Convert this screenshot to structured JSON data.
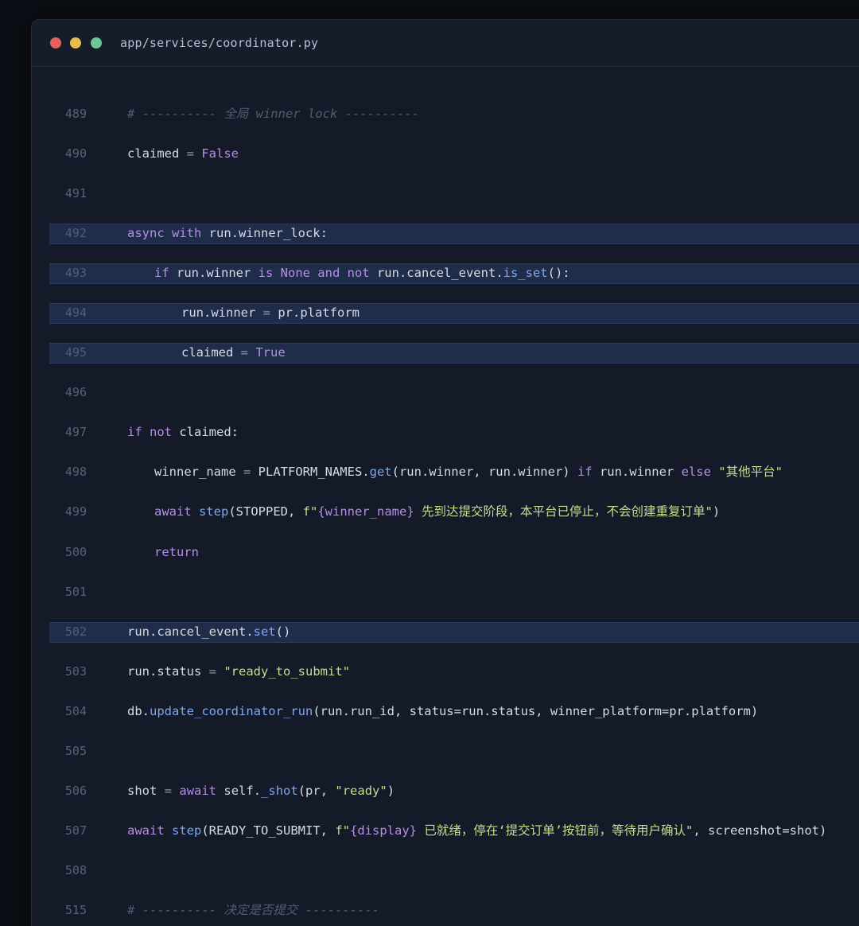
{
  "editor": {
    "filename": "app/services/coordinator.py"
  },
  "theme": {
    "keyword": "#b58ee8",
    "function": "#7fa7ee",
    "string": "#c6dc8e",
    "comment": "#525d70",
    "plain": "#d6dbe4",
    "highlight": "#1f2c4a"
  },
  "lines": [
    {
      "num": "489",
      "indent": 0,
      "highlighted": false,
      "tokens": [
        {
          "t": "cm",
          "v": "# ---------- 全局 winner lock ----------"
        }
      ]
    },
    {
      "num": "490",
      "indent": 0,
      "highlighted": false,
      "tokens": [
        {
          "t": "pl",
          "v": "claimed "
        },
        {
          "t": "op",
          "v": "="
        },
        {
          "t": "pl",
          "v": " "
        },
        {
          "t": "kw",
          "v": "False"
        }
      ]
    },
    {
      "num": "491",
      "indent": 0,
      "highlighted": false,
      "tokens": []
    },
    {
      "num": "492",
      "indent": 0,
      "highlighted": true,
      "tokens": [
        {
          "t": "kw",
          "v": "async with"
        },
        {
          "t": "pl",
          "v": " run.winner_lock:"
        }
      ]
    },
    {
      "num": "493",
      "indent": 1,
      "highlighted": true,
      "tokens": [
        {
          "t": "kw",
          "v": "if"
        },
        {
          "t": "pl",
          "v": " run.winner "
        },
        {
          "t": "kw",
          "v": "is None and not"
        },
        {
          "t": "pl",
          "v": " run.cancel_event."
        },
        {
          "t": "fn",
          "v": "is_set"
        },
        {
          "t": "pl",
          "v": "():"
        }
      ]
    },
    {
      "num": "494",
      "indent": 2,
      "highlighted": true,
      "tokens": [
        {
          "t": "pl",
          "v": "run.winner "
        },
        {
          "t": "op",
          "v": "="
        },
        {
          "t": "pl",
          "v": " pr.platform"
        }
      ]
    },
    {
      "num": "495",
      "indent": 2,
      "highlighted": true,
      "tokens": [
        {
          "t": "pl",
          "v": "claimed "
        },
        {
          "t": "op",
          "v": "="
        },
        {
          "t": "pl",
          "v": " "
        },
        {
          "t": "kw",
          "v": "True"
        }
      ]
    },
    {
      "num": "496",
      "indent": 0,
      "highlighted": false,
      "tokens": []
    },
    {
      "num": "497",
      "indent": 0,
      "highlighted": false,
      "tokens": [
        {
          "t": "kw",
          "v": "if not"
        },
        {
          "t": "pl",
          "v": " claimed:"
        }
      ]
    },
    {
      "num": "498",
      "indent": 1,
      "highlighted": false,
      "tokens": [
        {
          "t": "pl",
          "v": "winner_name "
        },
        {
          "t": "op",
          "v": "="
        },
        {
          "t": "pl",
          "v": " PLATFORM_NAMES."
        },
        {
          "t": "fn",
          "v": "get"
        },
        {
          "t": "pl",
          "v": "(run.winner, run.winner) "
        },
        {
          "t": "kw",
          "v": "if"
        },
        {
          "t": "pl",
          "v": " run.winner "
        },
        {
          "t": "kw",
          "v": "else"
        },
        {
          "t": "pl",
          "v": " "
        },
        {
          "t": "str",
          "v": "\"其他平台\""
        }
      ]
    },
    {
      "num": "499",
      "indent": 1,
      "highlighted": false,
      "tokens": [
        {
          "t": "kw",
          "v": "await"
        },
        {
          "t": "pl",
          "v": " "
        },
        {
          "t": "fn",
          "v": "step"
        },
        {
          "t": "pl",
          "v": "(STOPPED, "
        },
        {
          "t": "str",
          "v": "f\""
        },
        {
          "t": "kw",
          "v": "{winner_name}"
        },
        {
          "t": "str",
          "v": " 先到达提交阶段，本平台已停止，不会创建重复订单\""
        },
        {
          "t": "pl",
          "v": ")"
        }
      ]
    },
    {
      "num": "500",
      "indent": 1,
      "highlighted": false,
      "tokens": [
        {
          "t": "kw",
          "v": "return"
        }
      ]
    },
    {
      "num": "501",
      "indent": 0,
      "highlighted": false,
      "tokens": []
    },
    {
      "num": "502",
      "indent": 0,
      "highlighted": true,
      "tokens": [
        {
          "t": "pl",
          "v": "run.cancel_event."
        },
        {
          "t": "fn",
          "v": "set"
        },
        {
          "t": "pl",
          "v": "()"
        }
      ]
    },
    {
      "num": "503",
      "indent": 0,
      "highlighted": false,
      "tokens": [
        {
          "t": "pl",
          "v": "run.status "
        },
        {
          "t": "op",
          "v": "="
        },
        {
          "t": "pl",
          "v": " "
        },
        {
          "t": "str",
          "v": "\"ready_to_submit\""
        }
      ]
    },
    {
      "num": "504",
      "indent": 0,
      "highlighted": false,
      "tokens": [
        {
          "t": "pl",
          "v": "db."
        },
        {
          "t": "fn",
          "v": "update_coordinator_run"
        },
        {
          "t": "pl",
          "v": "(run.run_id, status=run.status, winner_platform=pr.platform)"
        }
      ]
    },
    {
      "num": "505",
      "indent": 0,
      "highlighted": false,
      "tokens": []
    },
    {
      "num": "506",
      "indent": 0,
      "highlighted": false,
      "tokens": [
        {
          "t": "pl",
          "v": "shot "
        },
        {
          "t": "op",
          "v": "="
        },
        {
          "t": "pl",
          "v": " "
        },
        {
          "t": "kw",
          "v": "await"
        },
        {
          "t": "pl",
          "v": " self."
        },
        {
          "t": "fn",
          "v": "_shot"
        },
        {
          "t": "pl",
          "v": "(pr, "
        },
        {
          "t": "str",
          "v": "\"ready\""
        },
        {
          "t": "pl",
          "v": ")"
        }
      ]
    },
    {
      "num": "507",
      "indent": 0,
      "highlighted": false,
      "tokens": [
        {
          "t": "kw",
          "v": "await"
        },
        {
          "t": "pl",
          "v": " "
        },
        {
          "t": "fn",
          "v": "step"
        },
        {
          "t": "pl",
          "v": "(READY_TO_SUBMIT, "
        },
        {
          "t": "str",
          "v": "f\""
        },
        {
          "t": "kw",
          "v": "{display}"
        },
        {
          "t": "str",
          "v": " 已就绪，停在‘提交订单’按钮前，等待用户确认\""
        },
        {
          "t": "pl",
          "v": ", screenshot=shot)"
        }
      ]
    },
    {
      "num": "508",
      "indent": 0,
      "highlighted": false,
      "tokens": []
    },
    {
      "num": "515",
      "indent": 0,
      "highlighted": false,
      "tokens": [
        {
          "t": "cm",
          "v": "# ---------- 决定是否提交 ----------"
        }
      ]
    }
  ]
}
